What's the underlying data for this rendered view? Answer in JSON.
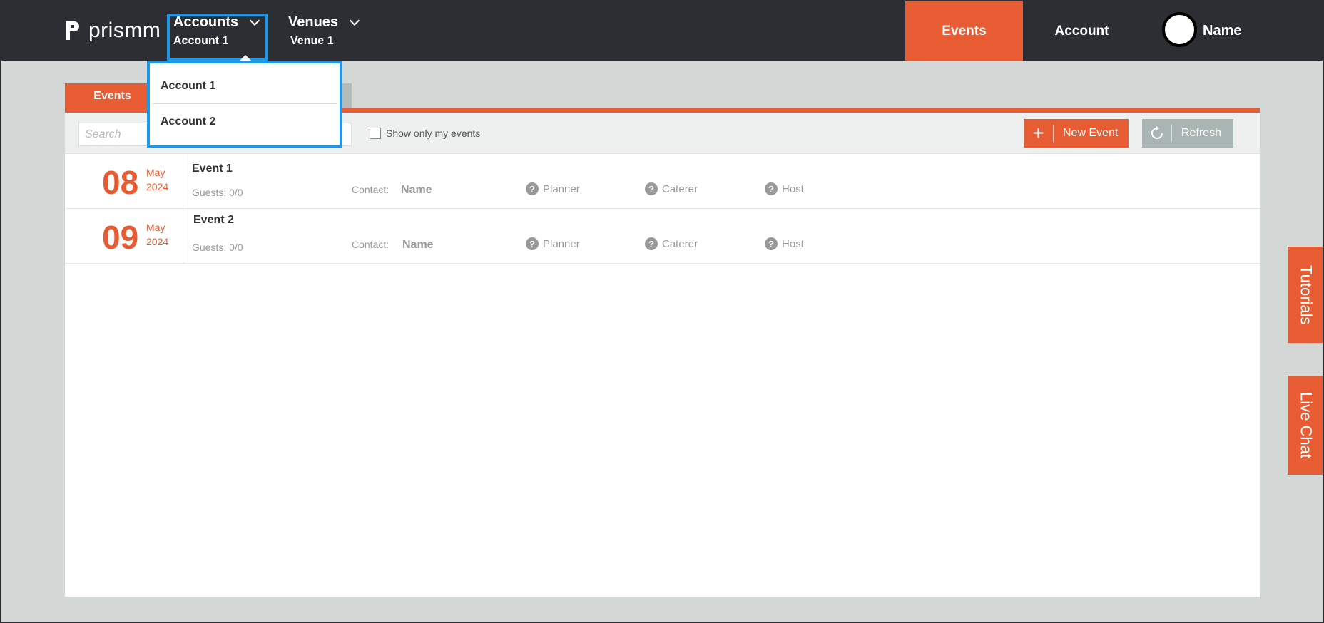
{
  "header": {
    "logo_text": "prismm",
    "accounts": {
      "label": "Accounts",
      "selected": "Account 1"
    },
    "venues": {
      "label": "Venues",
      "selected": "Venue 1"
    },
    "tabs": [
      {
        "label": "Events"
      },
      {
        "label": "Account"
      }
    ],
    "user_name": "Name"
  },
  "accounts_dropdown": {
    "items": [
      {
        "label": "Account 1"
      },
      {
        "label": "Account 2"
      }
    ]
  },
  "main": {
    "tab_label": "Events",
    "search_placeholder": "Search",
    "show_only_mine_label": "Show only my events",
    "new_event_label": "New Event",
    "refresh_label": "Refresh",
    "events": [
      {
        "day": "08",
        "month": "May",
        "year": "2024",
        "name": "Event 1",
        "guests": "Guests: 0/0",
        "contact_label": "Contact:",
        "contact_name": "Name",
        "roles": [
          "Planner",
          "Caterer",
          "Host"
        ]
      },
      {
        "day": "09",
        "month": "May",
        "year": "2024",
        "name": "Event 2",
        "guests": "Guests: 0/0",
        "contact_label": "Contact:",
        "contact_name": "Name",
        "roles": [
          "Planner",
          "Caterer",
          "Host"
        ]
      }
    ]
  },
  "side_tabs": {
    "tutorials": "Tutorials",
    "live_chat": "Live Chat"
  },
  "colors": {
    "brand_orange": "#e85c34",
    "topbar": "#2c2e33",
    "highlight_blue": "#1d97e6"
  },
  "icons": [
    "prismm-logo-icon",
    "chevron-down-icon",
    "plus-icon",
    "refresh-icon",
    "question-icon"
  ]
}
